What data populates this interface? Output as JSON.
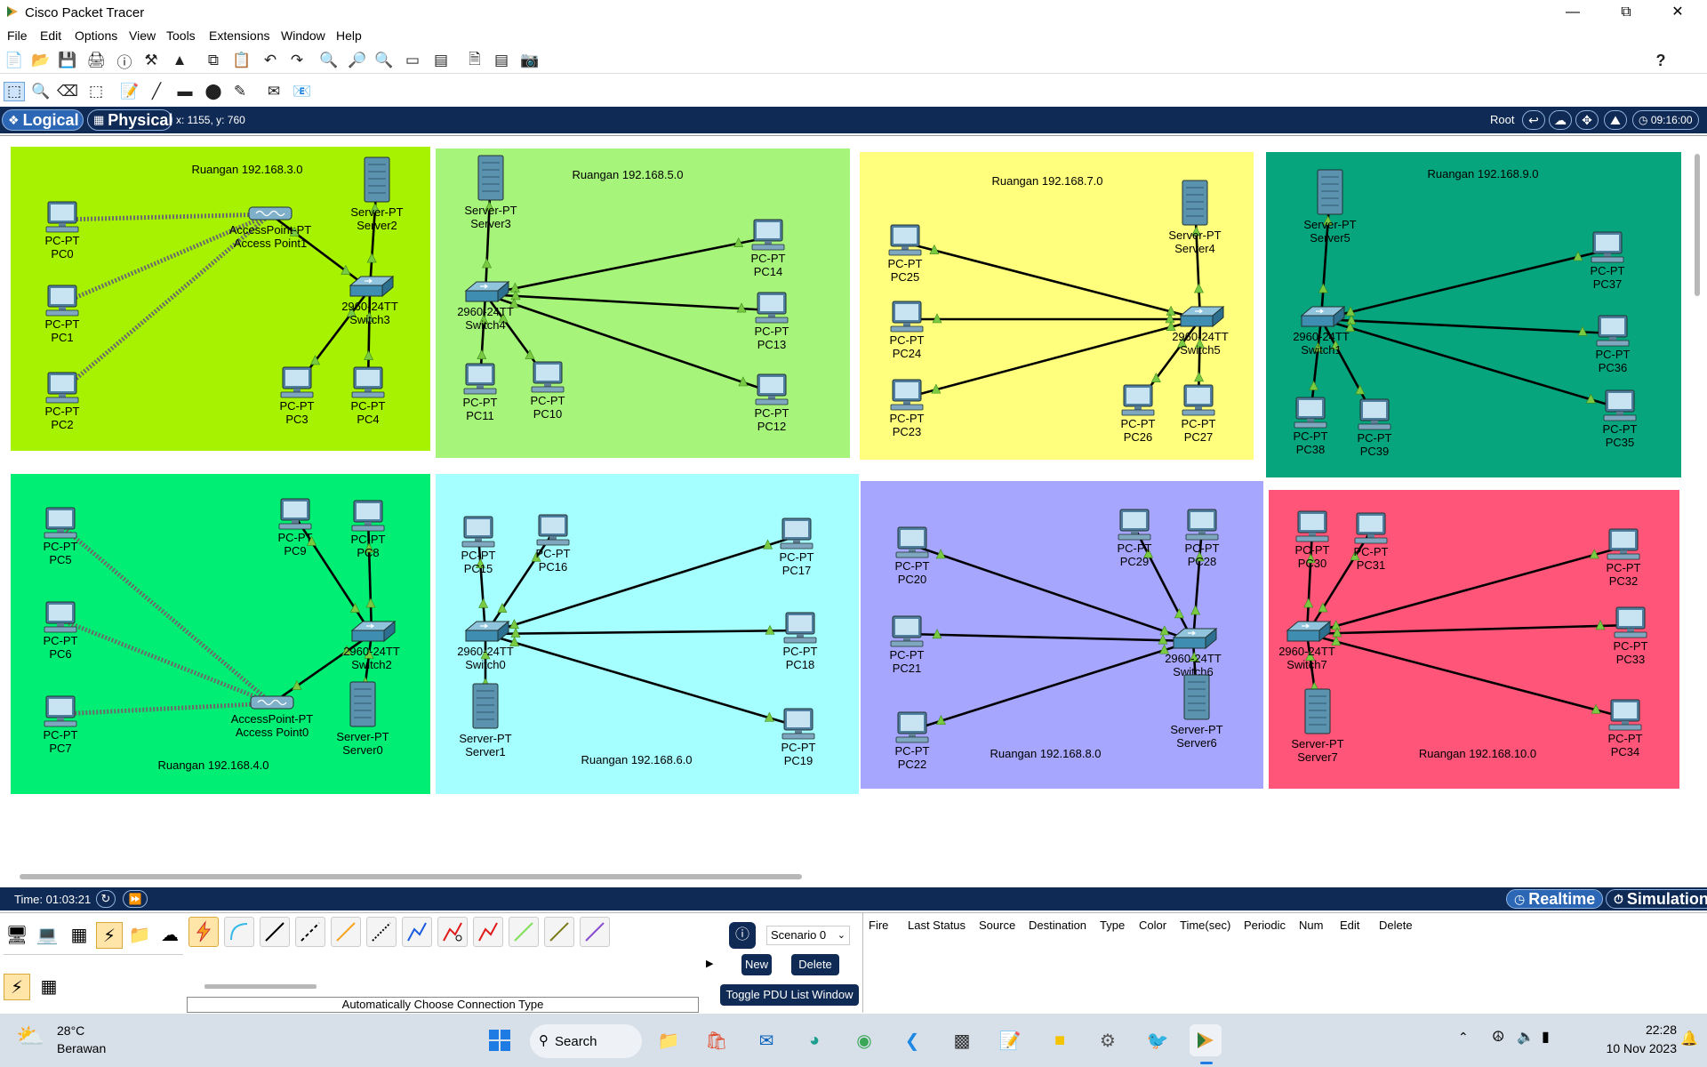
{
  "window": {
    "title": "Cisco Packet Tracer"
  },
  "menu": [
    "File",
    "Edit",
    "Options",
    "View",
    "Tools",
    "Extensions",
    "Window",
    "Help"
  ],
  "bluebar": {
    "logical_label": "Logical",
    "physical_label": "Physical",
    "coords": "x: 1155, y: 760",
    "root_label": "Root",
    "clock": "09:16:00"
  },
  "rooms": [
    {
      "label": "Ruangan 192.168.3.0",
      "color": "#a6f200"
    },
    {
      "label": "Ruangan 192.168.5.0",
      "color": "#a6f57a"
    },
    {
      "label": "Ruangan 192.168.7.0",
      "color": "#ffff7d"
    },
    {
      "label": "Ruangan 192.168.9.0",
      "color": "#06a57d"
    },
    {
      "label": "Ruangan 192.168.4.0",
      "color": "#00ee73"
    },
    {
      "label": "Ruangan 192.168.6.0",
      "color": "#a6ffff"
    },
    {
      "label": "Ruangan 192.168.8.0",
      "color": "#a6a6ff"
    },
    {
      "label": "Ruangan 192.168.10.0",
      "color": "#ff5579"
    }
  ],
  "devices": {
    "PC0": [
      "PC-PT",
      "PC0"
    ],
    "PC1": [
      "PC-PT",
      "PC1"
    ],
    "PC2": [
      "PC-PT",
      "PC2"
    ],
    "PC3": [
      "PC-PT",
      "PC3"
    ],
    "PC4": [
      "PC-PT",
      "PC4"
    ],
    "PC5": [
      "PC-PT",
      "PC5"
    ],
    "PC6": [
      "PC-PT",
      "PC6"
    ],
    "PC7": [
      "PC-PT",
      "PC7"
    ],
    "PC8": [
      "PC-PT",
      "PC8"
    ],
    "PC9": [
      "PC-PT",
      "PC9"
    ],
    "PC10": [
      "PC-PT",
      "PC10"
    ],
    "PC11": [
      "PC-PT",
      "PC11"
    ],
    "PC12": [
      "PC-PT",
      "PC12"
    ],
    "PC13": [
      "PC-PT",
      "PC13"
    ],
    "PC14": [
      "PC-PT",
      "PC14"
    ],
    "PC15": [
      "PC-PT",
      "PC15"
    ],
    "PC16": [
      "PC-PT",
      "PC16"
    ],
    "PC17": [
      "PC-PT",
      "PC17"
    ],
    "PC18": [
      "PC-PT",
      "PC18"
    ],
    "PC19": [
      "PC-PT",
      "PC19"
    ],
    "PC20": [
      "PC-PT",
      "PC20"
    ],
    "PC21": [
      "PC-PT",
      "PC21"
    ],
    "PC22": [
      "PC-PT",
      "PC22"
    ],
    "PC23": [
      "PC-PT",
      "PC23"
    ],
    "PC24": [
      "PC-PT",
      "PC24"
    ],
    "PC25": [
      "PC-PT",
      "PC25"
    ],
    "PC26": [
      "PC-PT",
      "PC26"
    ],
    "PC27": [
      "PC-PT",
      "PC27"
    ],
    "PC28": [
      "PC-PT",
      "PC28"
    ],
    "PC29": [
      "PC-PT",
      "PC29"
    ],
    "PC30": [
      "PC-PT",
      "PC30"
    ],
    "PC31": [
      "PC-PT",
      "PC31"
    ],
    "PC32": [
      "PC-PT",
      "PC32"
    ],
    "PC33": [
      "PC-PT",
      "PC33"
    ],
    "PC34": [
      "PC-PT",
      "PC34"
    ],
    "PC35": [
      "PC-PT",
      "PC35"
    ],
    "PC36": [
      "PC-PT",
      "PC36"
    ],
    "PC37": [
      "PC-PT",
      "PC37"
    ],
    "PC38": [
      "PC-PT",
      "PC38"
    ],
    "PC39": [
      "PC-PT",
      "PC39"
    ],
    "Server0": [
      "Server-PT",
      "Server0"
    ],
    "Server1": [
      "Server-PT",
      "Server1"
    ],
    "Server2": [
      "Server-PT",
      "Server2"
    ],
    "Server3": [
      "Server-PT",
      "Server3"
    ],
    "Server4": [
      "Server-PT",
      "Server4"
    ],
    "Server5": [
      "Server-PT",
      "Server5"
    ],
    "Server6": [
      "Server-PT",
      "Server6"
    ],
    "Server7": [
      "Server-PT",
      "Server7"
    ],
    "Switch0": [
      "2960-24TT",
      "Switch0"
    ],
    "Switch1": [
      "2960-24TT",
      "Switch1"
    ],
    "Switch2": [
      "2960-24TT",
      "Switch2"
    ],
    "Switch3": [
      "2960-24TT",
      "Switch3"
    ],
    "Switch4": [
      "2960-24TT",
      "Switch4"
    ],
    "Switch5": [
      "2960-24TT",
      "Switch5"
    ],
    "Switch6": [
      "2960-24TT",
      "Switch6"
    ],
    "Switch7": [
      "2960-24TT",
      "Switch7"
    ],
    "AP0": [
      "AccessPoint-PT",
      "Access Point0"
    ],
    "AP1": [
      "AccessPoint-PT",
      "Access Point1"
    ]
  },
  "links": {
    "wired": [
      [
        "Switch3",
        "Server2"
      ],
      [
        "Switch3",
        "PC3"
      ],
      [
        "Switch3",
        "PC4"
      ],
      [
        "Switch3",
        "AP1"
      ],
      [
        "Switch4",
        "Server3"
      ],
      [
        "Switch4",
        "PC11"
      ],
      [
        "Switch4",
        "PC10"
      ],
      [
        "Switch4",
        "PC14"
      ],
      [
        "Switch4",
        "PC13"
      ],
      [
        "Switch4",
        "PC12"
      ],
      [
        "Switch5",
        "Server4"
      ],
      [
        "Switch5",
        "PC25"
      ],
      [
        "Switch5",
        "PC24"
      ],
      [
        "Switch5",
        "PC23"
      ],
      [
        "Switch5",
        "PC26"
      ],
      [
        "Switch5",
        "PC27"
      ],
      [
        "Switch1",
        "Server5"
      ],
      [
        "Switch1",
        "PC37"
      ],
      [
        "Switch1",
        "PC36"
      ],
      [
        "Switch1",
        "PC35"
      ],
      [
        "Switch1",
        "PC38"
      ],
      [
        "Switch1",
        "PC39"
      ],
      [
        "Switch2",
        "PC9"
      ],
      [
        "Switch2",
        "PC8"
      ],
      [
        "Switch2",
        "Server0"
      ],
      [
        "Switch2",
        "AP0"
      ],
      [
        "Switch0",
        "PC15"
      ],
      [
        "Switch0",
        "PC16"
      ],
      [
        "Switch0",
        "PC17"
      ],
      [
        "Switch0",
        "PC18"
      ],
      [
        "Switch0",
        "PC19"
      ],
      [
        "Switch0",
        "Server1"
      ],
      [
        "Switch6",
        "PC20"
      ],
      [
        "Switch6",
        "PC21"
      ],
      [
        "Switch6",
        "PC22"
      ],
      [
        "Switch6",
        "PC29"
      ],
      [
        "Switch6",
        "PC28"
      ],
      [
        "Switch6",
        "Server6"
      ],
      [
        "Switch7",
        "PC30"
      ],
      [
        "Switch7",
        "PC31"
      ],
      [
        "Switch7",
        "PC32"
      ],
      [
        "Switch7",
        "PC33"
      ],
      [
        "Switch7",
        "PC34"
      ],
      [
        "Switch7",
        "Server7"
      ]
    ],
    "wireless": [
      [
        "AP1",
        "PC0"
      ],
      [
        "AP1",
        "PC1"
      ],
      [
        "AP1",
        "PC2"
      ],
      [
        "AP0",
        "PC5"
      ],
      [
        "AP0",
        "PC6"
      ],
      [
        "AP0",
        "PC7"
      ]
    ]
  },
  "timebar": {
    "time_label": "Time: 01:03:21",
    "realtime_label": "Realtime",
    "simulation_label": "Simulation"
  },
  "bottom": {
    "auto_connection_label": "Automatically Choose Connection Type",
    "scenario_label": "Scenario 0",
    "new_label": "New",
    "delete_label": "Delete",
    "toggle_pdu_label": "Toggle PDU List Window",
    "pdu_columns": [
      "Fire",
      "Last Status",
      "Source",
      "Destination",
      "Type",
      "Color",
      "Time(sec)",
      "Periodic",
      "Num",
      "Edit",
      "Delete"
    ]
  },
  "taskbar": {
    "temperature": "28°C",
    "weather": "Berawan",
    "search_label": "Search",
    "time": "22:28",
    "date": "10 Nov 2023"
  },
  "colors": {
    "link": "#000000",
    "wireless": "#6b6b6b",
    "link_light": "#7ac943",
    "accent": "#0f2a54"
  }
}
